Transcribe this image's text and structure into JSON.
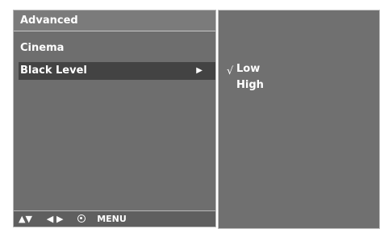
{
  "menu": {
    "title": "Advanced",
    "items": [
      {
        "label": "Cinema",
        "selected": false
      },
      {
        "label": "Black Level",
        "selected": true,
        "submenu_arrow": "▶"
      }
    ]
  },
  "footer": {
    "updown": "▲▼",
    "leftright": "◀ ▶",
    "ok_icon": "ok-circle-icon",
    "menu_label": "MENU"
  },
  "submenu": {
    "check_mark": "√",
    "options": [
      {
        "label": "Low",
        "checked": true
      },
      {
        "label": "High",
        "checked": false
      }
    ]
  },
  "colors": {
    "panel": "#6e6e6e",
    "selected_row": "#434343",
    "text": "#ffffff"
  }
}
